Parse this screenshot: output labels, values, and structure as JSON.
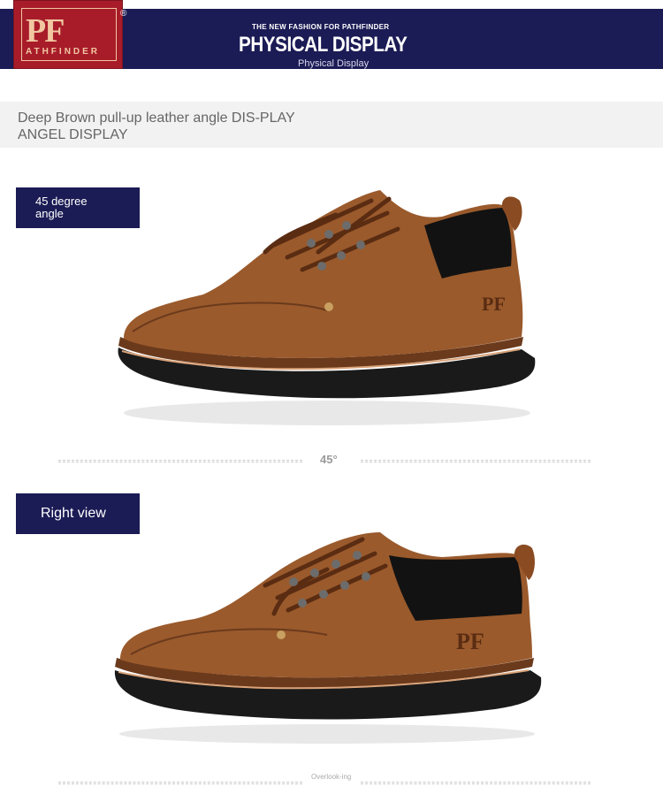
{
  "header": {
    "logo_letters": "PF",
    "logo_word": "ATHFINDER",
    "logo_reg": "®",
    "tagline": "THE NEW FASHION FOR PATHFINDER",
    "title": "PHYSICAL DISPLAY",
    "subtitle": "Physical Display"
  },
  "description": "Deep Brown pull-up leather angle DIS-PLAY ANGEL DISPLAY",
  "views": [
    {
      "label": "45 degree angle",
      "divider_label": "45°"
    },
    {
      "label": "Right view",
      "divider_label": "Overlook-ing"
    }
  ],
  "colors": {
    "navy": "#1b1b55",
    "logo_red": "#a81c2a",
    "leather": "#9a5a2c",
    "sole": "#1a1a1a"
  },
  "icons": [
    "pf-logo",
    "shoe-45-degree-photo",
    "shoe-right-view-photo"
  ]
}
